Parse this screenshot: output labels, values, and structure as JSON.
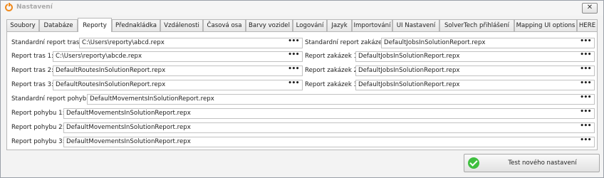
{
  "window": {
    "title": "Nastavení",
    "close_glyph": "✕",
    "app_icon": "power-icon",
    "accent": "#f08a1c"
  },
  "tabs": [
    {
      "label": "Soubory",
      "active": false
    },
    {
      "label": "Databáze",
      "active": false
    },
    {
      "label": "Reporty",
      "active": true
    },
    {
      "label": "Přednakládka",
      "active": false
    },
    {
      "label": "Vzdálenosti",
      "active": false
    },
    {
      "label": "Časová osa",
      "active": false
    },
    {
      "label": "Barvy vozidel",
      "active": false
    },
    {
      "label": "Logování",
      "active": false
    },
    {
      "label": "Jazyk",
      "active": false
    },
    {
      "label": "Importování",
      "active": false
    },
    {
      "label": "UI Nastavení",
      "active": false
    },
    {
      "label": "SolverTech přihlášení",
      "active": false
    },
    {
      "label": "Mapping UI options",
      "active": false
    },
    {
      "label": "HERE",
      "active": false
    }
  ],
  "reports": {
    "browse_glyph": "•••",
    "left": [
      {
        "label": "Standardní report tras:",
        "value": "C:\\Users\\reporty\\abcd.repx"
      },
      {
        "label": "Report tras 1:",
        "value": "C:\\Users\\reporty\\abcde.repx"
      },
      {
        "label": "Report tras 2:",
        "value": "DefaultRoutesInSolutionReport.repx"
      },
      {
        "label": "Report tras 3:",
        "value": "DefaultRoutesInSolutionReport.repx"
      }
    ],
    "right": [
      {
        "label": "Standardní report zakázek:",
        "value": "DefaultJobsInSolutionReport.repx"
      },
      {
        "label": "Report zakázek 1:",
        "value": "DefaultJobsInSolutionReport.repx"
      },
      {
        "label": "Report zakázek 2:",
        "value": "DefaultJobsInSolutionReport.repx"
      },
      {
        "label": "Report zakázek 3:",
        "value": "DefaultJobsInSolutionReport.repx"
      }
    ],
    "movement_default": {
      "label": "Standardní report pohybu:",
      "value": "DefaultMovementsInSolutionReport.repx"
    },
    "movements": [
      {
        "label": "Report pohybu 1:",
        "value": "DefaultMovementsInSolutionReport.repx"
      },
      {
        "label": "Report pohybu 2:",
        "value": "DefaultMovementsInSolutionReport.repx"
      },
      {
        "label": "Report pohybu 3:",
        "value": "DefaultMovementsInSolutionReport.repx"
      }
    ]
  },
  "footer": {
    "test_button": "Test nového nastavení",
    "test_icon": "check-circle-icon",
    "test_icon_color": "#3fbf3f"
  }
}
